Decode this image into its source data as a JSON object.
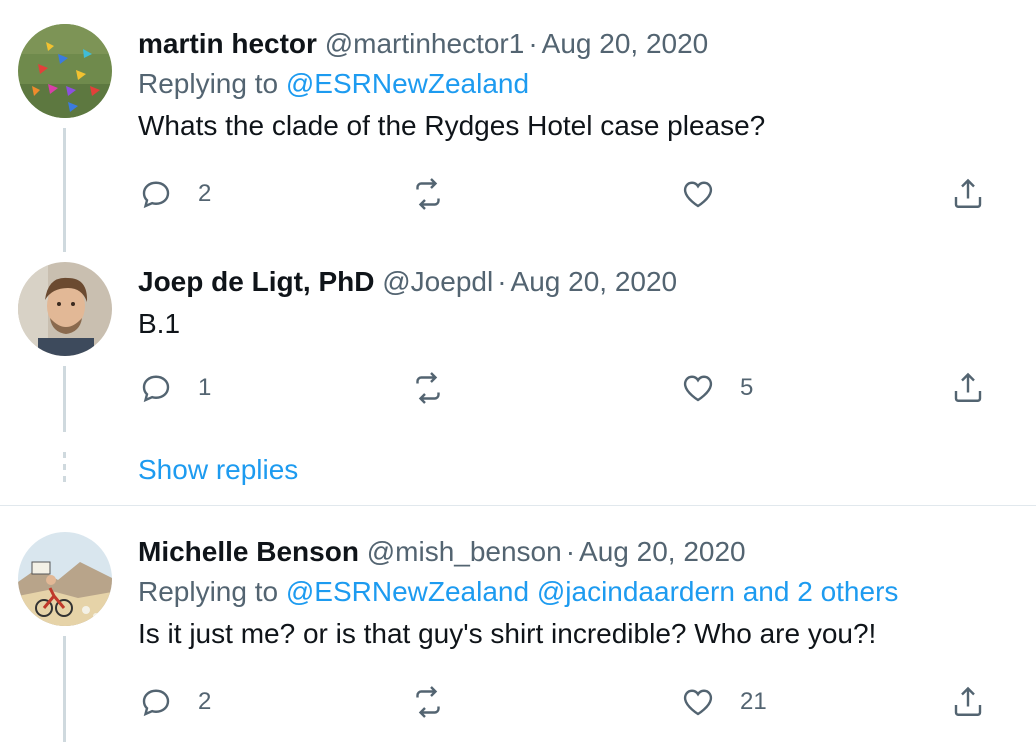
{
  "tweets": [
    {
      "name": "martin hector",
      "handle": "@martinhector1",
      "sep": "·",
      "date": "Aug 20, 2020",
      "replying_prefix": "Replying to",
      "replying_to": "@ESRNewZealand",
      "text": "Whats the clade of the Rydges Hotel case please?",
      "replies": "2",
      "retweets": "",
      "likes": ""
    },
    {
      "name": "Joep de Ligt, PhD",
      "handle": "@Joepdl",
      "sep": "·",
      "date": "Aug 20, 2020",
      "text": "B.1",
      "replies": "1",
      "retweets": "",
      "likes": "5"
    },
    {
      "name": "Michelle Benson",
      "handle": "@mish_benson",
      "sep": "·",
      "date": "Aug 20, 2020",
      "replying_prefix": "Replying to",
      "replying_to": "@ESRNewZealand @jacindaardern and 2 others",
      "text": "Is it just me? or is that guy's shirt incredible? Who are you?!",
      "replies": "2",
      "retweets": "",
      "likes": "21"
    }
  ],
  "show_replies": "Show replies",
  "icons": [
    "reply-icon",
    "retweet-icon",
    "like-icon",
    "share-icon"
  ],
  "colors": {
    "link": "#1d9bf0",
    "muted": "#536471",
    "text": "#0f1419",
    "thread": "#cfd9de"
  }
}
